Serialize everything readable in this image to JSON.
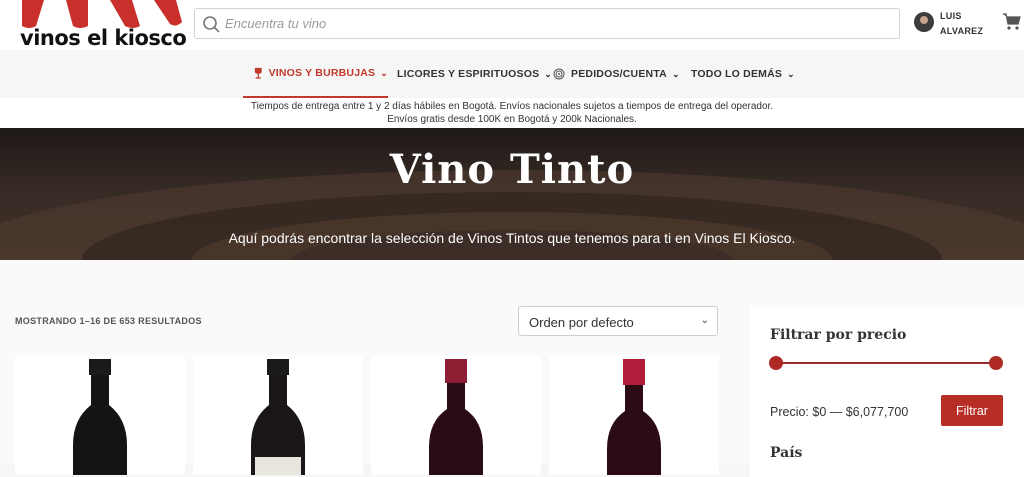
{
  "header": {
    "logo_text": "vinos el kiosco",
    "search_placeholder": "Encuentra tu vino",
    "user_first": "LUIS",
    "user_last": "ALVAREZ"
  },
  "nav": {
    "items": [
      {
        "label": "VINOS Y BURBUJAS",
        "icon": "wine-glass-icon",
        "active": true
      },
      {
        "label": "LICORES Y ESPIRITUOSOS",
        "active": false
      },
      {
        "label": "PEDIDOS/CUENTA",
        "icon": "fingerprint-icon",
        "active": false
      },
      {
        "label": "TODO LO DEMÁS",
        "active": false
      }
    ]
  },
  "notice": {
    "line1": "Tiempos de entrega entre 1 y 2 días hábiles en Bogotá. Envíos nacionales sujetos a tiempos de entrega del operador.",
    "line2": "Envíos gratis desde 100K en Bogotá y 200k Nacionales."
  },
  "hero": {
    "title": "Vino Tinto",
    "subtitle": "Aquí podrás encontrar la selección de Vinos Tintos que tenemos para ti en Vinos El Kiosco."
  },
  "shop": {
    "results_text": "MOSTRANDO 1–16 DE 653 RESULTADOS",
    "sort_value": "Orden por defecto"
  },
  "sidebar": {
    "price_title": "Filtrar por precio",
    "price_range": "Precio: $0 — $6,077,700",
    "filter_button": "Filtrar",
    "country_title": "País"
  },
  "colors": {
    "accent": "#c0392b",
    "button": "#b72e27"
  }
}
